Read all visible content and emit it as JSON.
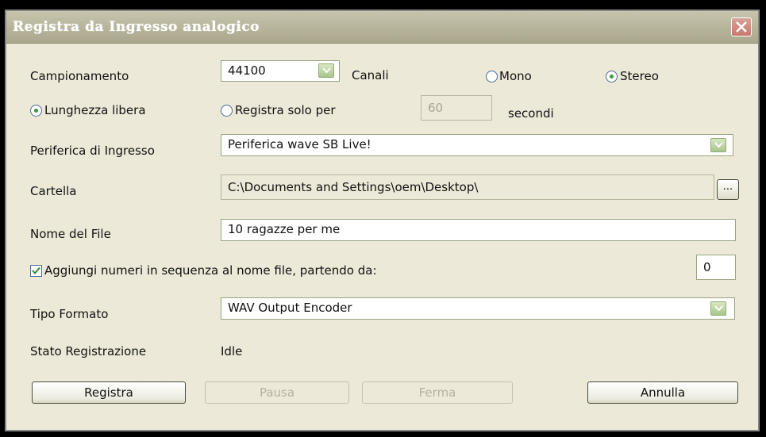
{
  "window": {
    "title": "Registra da Ingresso analogico"
  },
  "sampling": {
    "label": "Campionamento",
    "value": "44100"
  },
  "channels": {
    "label": "Canali",
    "mono_label": "Mono",
    "stereo_label": "Stereo",
    "selected": "Stereo"
  },
  "length": {
    "free_label": "Lunghezza libera",
    "limited_label": "Registra solo per",
    "seconds_value": "60",
    "seconds_unit": "secondi",
    "selected": "free"
  },
  "input_device": {
    "label": "Periferica di Ingresso",
    "value": "Periferica wave SB Live!"
  },
  "folder": {
    "label": "Cartella",
    "value": "C:\\Documents and Settings\\oem\\Desktop\\",
    "browse_label": "..."
  },
  "file_name": {
    "label": "Nome del File",
    "value": "10 ragazze per me"
  },
  "sequence": {
    "label": "Aggiungi numeri in sequenza al nome file, partendo da:",
    "checked": true,
    "start_value": "0"
  },
  "format": {
    "label": "Tipo Formato",
    "value": "WAV Output Encoder"
  },
  "status": {
    "label": "Stato Registrazione",
    "value": "Idle"
  },
  "buttons": {
    "record": "Registra",
    "pause": "Pausa",
    "stop": "Ferma",
    "cancel": "Annulla"
  }
}
